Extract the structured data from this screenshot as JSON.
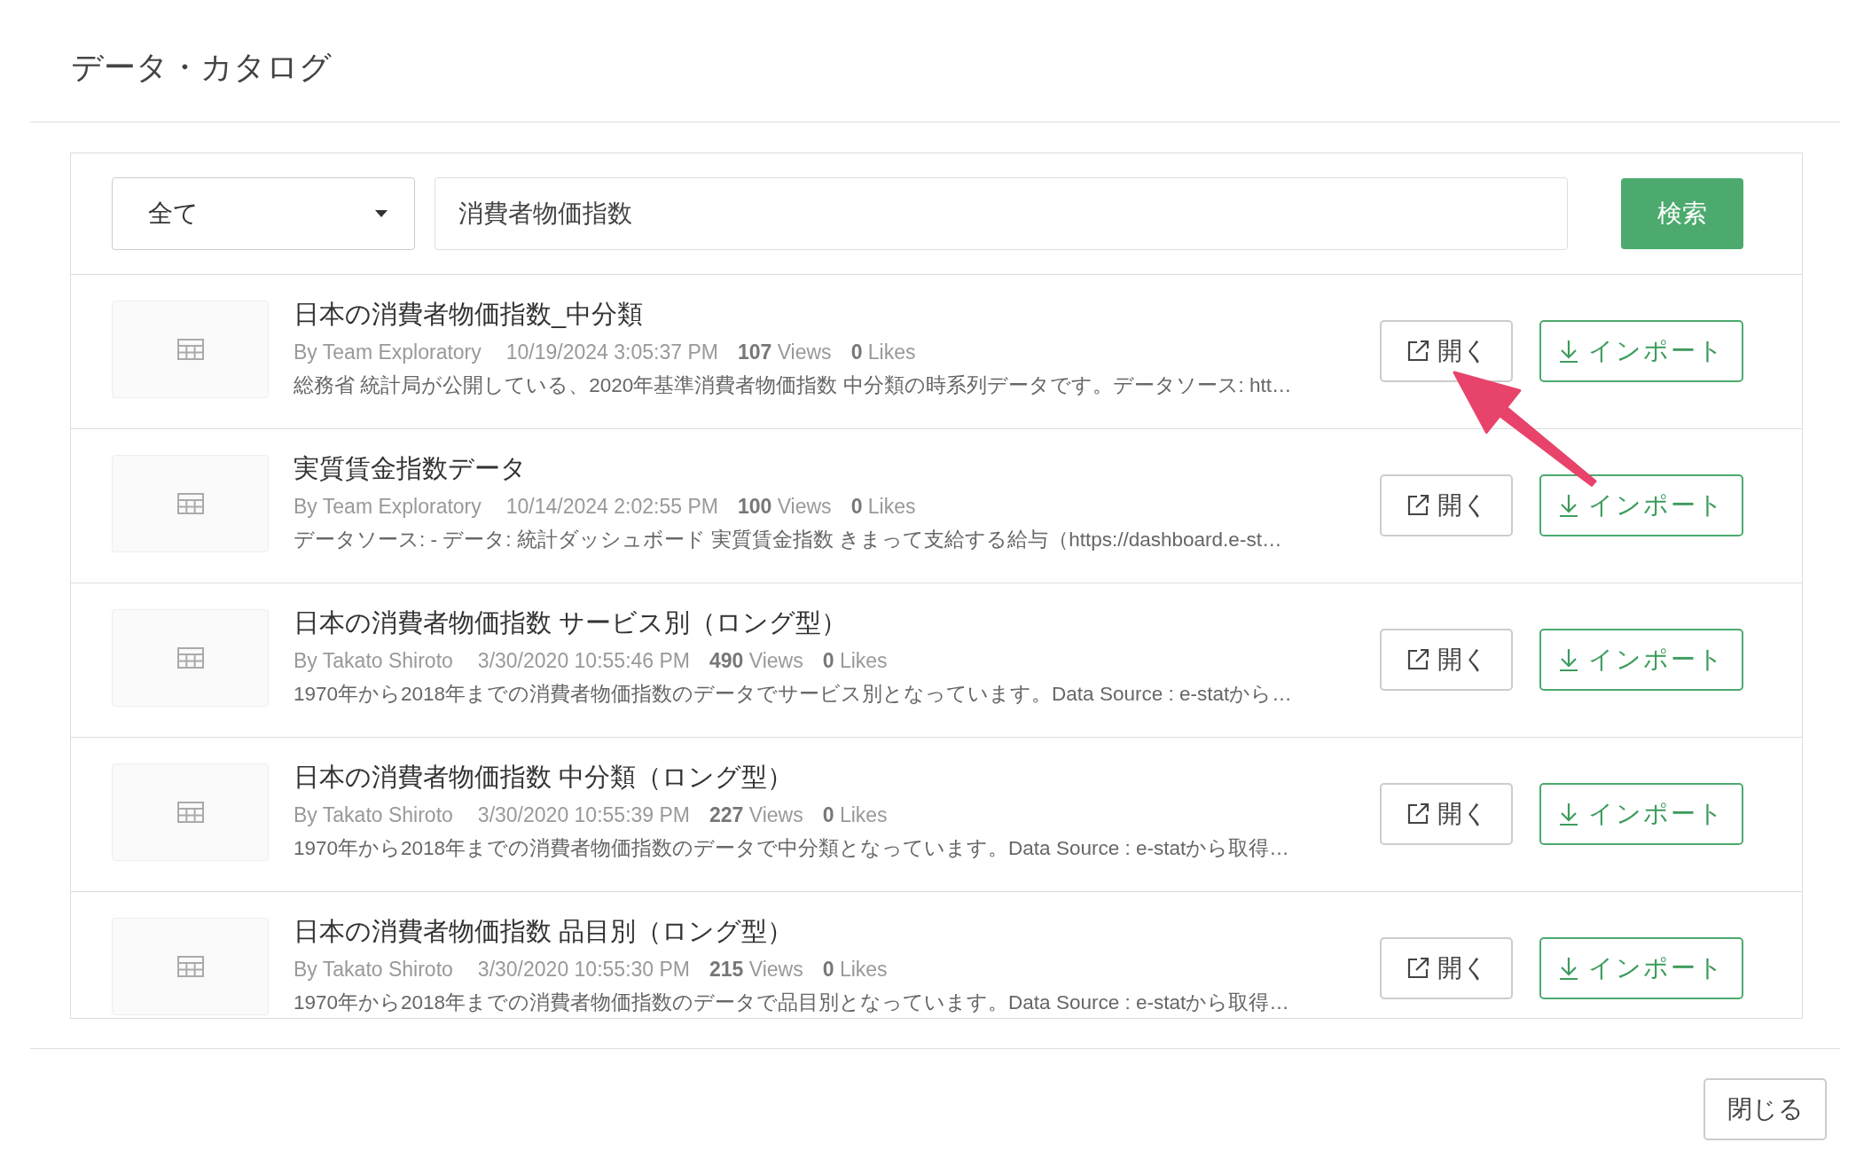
{
  "title": "データ・カタログ",
  "filter": {
    "value": "全て"
  },
  "search": {
    "value": "消費者物価指数",
    "button": "検索"
  },
  "datasets": [
    {
      "title": "日本の消費者物価指数_中分類",
      "author": "By Team Exploratory",
      "date": "10/19/2024 3:05:37 PM",
      "views": "**107** Views",
      "likes": "**0** Likes",
      "description": "総務省 統計局が公開している、2020年基準消費者物価指数 中分類の時系列データです。データソース: htt…",
      "open_button": "開く",
      "import_button": "インポート"
    },
    {
      "title": "実質賃金指数データ",
      "author": "By Team Exploratory",
      "date": "10/14/2024 2:02:55 PM",
      "views": "**100** Views",
      "likes": "**0** Likes",
      "description": "データソース: - データ: 統計ダッシュボード 実質賃金指数 きまって支給する給与（https://dashboard.e-st…",
      "open_button": "開く",
      "import_button": "インポート"
    },
    {
      "title": "日本の消費者物価指数 サービス別（ロング型）",
      "author": "By Takato Shiroto",
      "date": "3/30/2020 10:55:46 PM",
      "views": "**490** Views",
      "likes": "**0** Likes",
      "description": "1970年から2018年までの消費者物価指数のデータでサービス別となっています。Data Source : e-statから…",
      "open_button": "開く",
      "import_button": "インポート"
    },
    {
      "title": "日本の消費者物価指数 中分類（ロング型）",
      "author": "By Takato Shiroto",
      "date": "3/30/2020 10:55:39 PM",
      "views": "**227** Views",
      "likes": "**0** Likes",
      "description": "1970年から2018年までの消費者物価指数のデータで中分類となっています。Data Source : e-statから取得…",
      "open_button": "開く",
      "import_button": "インポート"
    },
    {
      "title": "日本の消費者物価指数 品目別（ロング型）",
      "author": "By Takato Shiroto",
      "date": "3/30/2020 10:55:30 PM",
      "views": "**215** Views",
      "likes": "**0** Likes",
      "description": "1970年から2018年までの消費者物価指数のデータで品目別となっています。Data Source : e-statから取得…",
      "open_button": "開く",
      "import_button": "インポート"
    }
  ],
  "close_button": "閉じる"
}
